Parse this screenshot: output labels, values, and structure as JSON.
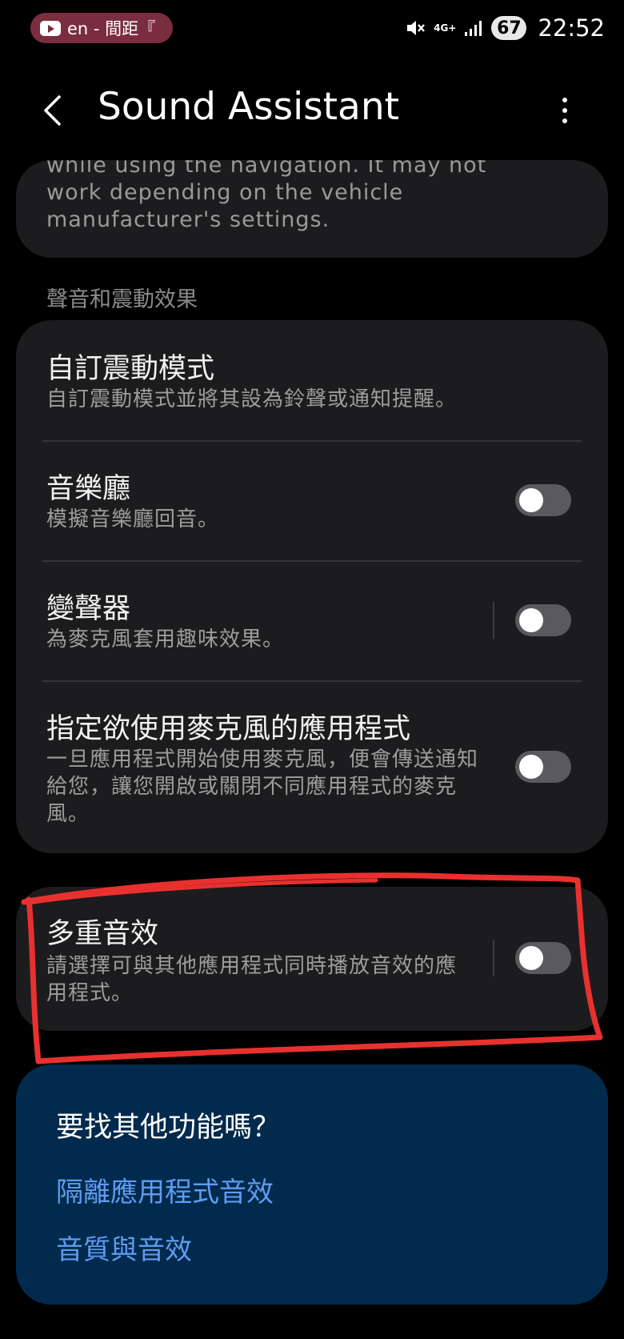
{
  "status_bar": {
    "notification_text": "en - 間距『",
    "network": "4G+",
    "battery": "67",
    "time": "22:52"
  },
  "app_bar": {
    "title": "Sound Assistant"
  },
  "top_card": {
    "text": "while using the navigation. It may not work depending on the vehicle manufacturer's settings."
  },
  "section": {
    "header": "聲音和震動效果"
  },
  "items": [
    {
      "title": "自訂震動模式",
      "subtitle": "自訂震動模式並將其設為鈴聲或通知提醒。",
      "has_toggle": false,
      "enabled": false
    },
    {
      "title": "音樂廳",
      "subtitle": "模擬音樂廳回音。",
      "has_toggle": true,
      "enabled": false
    },
    {
      "title": "變聲器",
      "subtitle": "為麥克風套用趣味效果。",
      "has_toggle": true,
      "enabled": false
    },
    {
      "title": "指定欲使用麥克風的應用程式",
      "subtitle": "一旦應用程式開始使用麥克風，便會傳送通知給您，讓您開啟或關閉不同應用程式的麥克風。",
      "has_toggle": true,
      "enabled": false
    }
  ],
  "multi_sound": {
    "title": "多重音效",
    "subtitle": "請選擇可與其他應用程式同時播放音效的應用程式。",
    "enabled": false
  },
  "looking_for": {
    "title": "要找其他功能嗎？",
    "links": [
      "隔離應用程式音效",
      "音質與音效"
    ]
  },
  "colors": {
    "background": "#000000",
    "card": "#1c1c1e",
    "blue_card": "#022a4d",
    "link": "#5f9cf0",
    "annotation": "#e8312f"
  },
  "icons": [
    "youtube-icon",
    "mute-icon",
    "signal-icon",
    "back-arrow-icon",
    "more-options-icon"
  ]
}
